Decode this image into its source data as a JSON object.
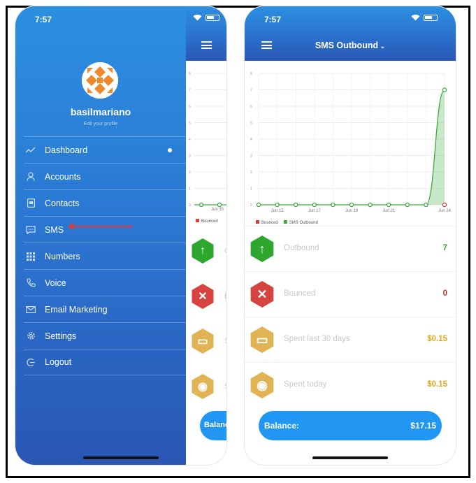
{
  "left_phone": {
    "time": "7:57",
    "username": "basilmariano",
    "edit_profile": "Edit your profile",
    "menu": [
      {
        "label": "Dashboard",
        "icon": "trend-icon",
        "active": true
      },
      {
        "label": "Accounts",
        "icon": "user-icon"
      },
      {
        "label": "Contacts",
        "icon": "contacts-icon"
      },
      {
        "label": "SMS",
        "icon": "chat-icon"
      },
      {
        "label": "Numbers",
        "icon": "keypad-icon"
      },
      {
        "label": "Voice",
        "icon": "phone-icon"
      },
      {
        "label": "Email Marketing",
        "icon": "mail-icon"
      },
      {
        "label": "Settings",
        "icon": "gear-icon"
      },
      {
        "label": "Logout",
        "icon": "logout-icon"
      }
    ],
    "behind": {
      "tick_jun15": "Jun 15",
      "legend_bounced": "Bounced",
      "row_letters": [
        "O",
        "B",
        "S",
        "S"
      ],
      "balance_stub": "Balance"
    }
  },
  "right_phone": {
    "time": "7:57",
    "title": "SMS Outbound",
    "stats": [
      {
        "label": "Outbound",
        "value": "7",
        "icon": "arrow-up-icon",
        "color": "#2fa72f",
        "value_color": "#2fa72f",
        "glyph": "↑"
      },
      {
        "label": "Bounced",
        "value": "0",
        "icon": "x-icon",
        "color": "#d7433e",
        "value_color": "#c0392b",
        "glyph": "✕"
      },
      {
        "label": "Spent last 30 days",
        "value": "$0.15",
        "icon": "card-icon",
        "color": "#e0b455",
        "value_color": "#e0a820",
        "glyph": "▭"
      },
      {
        "label": "Spent today",
        "value": "$0.15",
        "icon": "cash-icon",
        "color": "#e0b455",
        "value_color": "#e0a820",
        "glyph": "◉"
      }
    ],
    "balance_label": "Balance:",
    "balance_value": "$17.15"
  },
  "chart_data": {
    "type": "area",
    "x": [
      "Jun 14",
      "Jun 15",
      "Jun 16",
      "Jun 17",
      "Jun 18",
      "Jun 19",
      "Jun 20",
      "Jun 21",
      "Jun 22",
      "Jun 23",
      "Jun 24"
    ],
    "tick_labels": [
      "Jun 15",
      "Jun 17",
      "Jun 19",
      "Jun 21",
      "Jun 24"
    ],
    "series": [
      {
        "name": "Bounced",
        "values": [
          0,
          0,
          0,
          0,
          0,
          0,
          0,
          0,
          0,
          0,
          0
        ],
        "color": "#e53935"
      },
      {
        "name": "SMS Outbound",
        "values": [
          0,
          0,
          0,
          0,
          0,
          0,
          0,
          0,
          0,
          0,
          7
        ],
        "color": "#3da93d"
      }
    ],
    "ylim": [
      0,
      8
    ],
    "y_ticks": [
      0,
      1,
      2,
      3,
      4,
      5,
      6,
      7,
      8
    ],
    "grid": true,
    "legend": "bottom-left"
  }
}
